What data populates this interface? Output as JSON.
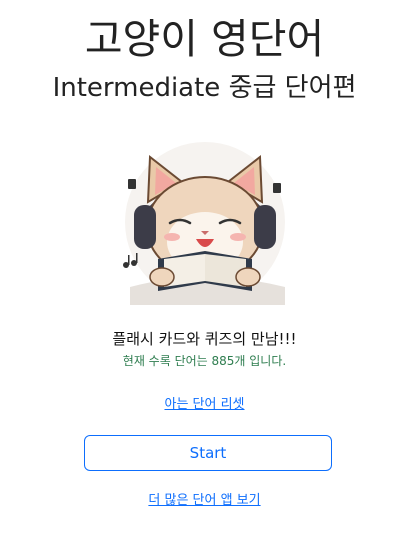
{
  "header": {
    "title": "고양이 영단어",
    "subtitle": "Intermediate 중급 단어편"
  },
  "hero": {
    "image": "cat-reading-book-with-headphones"
  },
  "main": {
    "tagline": "플래시 카드와 퀴즈의 만남!!!",
    "word_count_text": "현재 수록 단어는 885개 입니다.",
    "reset_link": "아는 단어 리셋",
    "start_label": "Start",
    "more_apps_link": "더 많은 단어 앱 보기"
  },
  "colors": {
    "accent": "#0d6efd",
    "count_text": "#2e7d4f"
  }
}
